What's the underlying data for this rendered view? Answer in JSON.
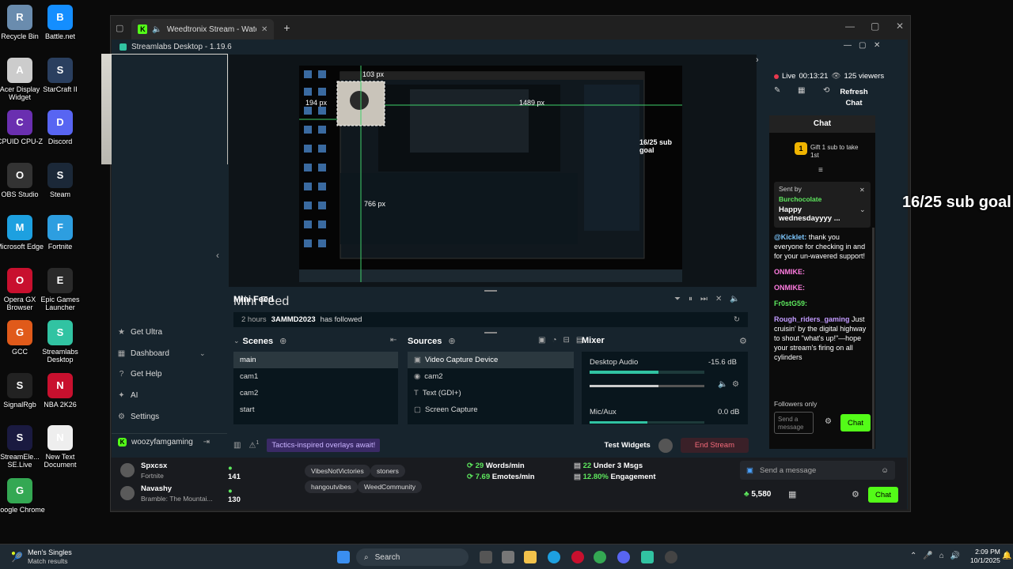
{
  "desktop_icons": [
    {
      "label": "Recycle Bin",
      "icon": "recycle-bin-icon",
      "color": "#6a8cae"
    },
    {
      "label": "Battle.net",
      "icon": "battlenet-icon",
      "color": "#148eff"
    },
    {
      "label": "Acer Display Widget",
      "icon": "acer-icon",
      "color": "#cccccc"
    },
    {
      "label": "StarCraft II",
      "icon": "starcraft-icon",
      "color": "#2a3f5f"
    },
    {
      "label": "CPUID CPU-Z",
      "icon": "cpuz-icon",
      "color": "#6a2fb0"
    },
    {
      "label": "Discord",
      "icon": "discord-icon",
      "color": "#5865f2"
    },
    {
      "label": "OBS Studio",
      "icon": "obs-icon",
      "color": "#333333"
    },
    {
      "label": "Steam",
      "icon": "steam-icon",
      "color": "#1b2838"
    },
    {
      "label": "Microsoft Edge",
      "icon": "edge-icon",
      "color": "#1da0e0"
    },
    {
      "label": "Fortnite",
      "icon": "fortnite-icon",
      "color": "#2d9ee0"
    },
    {
      "label": "Opera GX Browser",
      "icon": "opera-icon",
      "color": "#c8102e"
    },
    {
      "label": "Epic Games Launcher",
      "icon": "epic-icon",
      "color": "#2a2a2a"
    },
    {
      "label": "GCC",
      "icon": "gcc-icon",
      "color": "#e05a1a"
    },
    {
      "label": "Streamlabs Desktop",
      "icon": "streamlabs-icon",
      "color": "#31c3a2"
    },
    {
      "label": "SignalRgb",
      "icon": "signalrgb-icon",
      "color": "#222222"
    },
    {
      "label": "NBA 2K26",
      "icon": "nba-icon",
      "color": "#c8102e"
    },
    {
      "label": "StreamEle... SE.Live",
      "icon": "streamelements-icon",
      "color": "#1a1a40"
    },
    {
      "label": "New Text Document",
      "icon": "text-document-icon",
      "color": "#eeeeee"
    },
    {
      "label": "Google Chrome",
      "icon": "chrome-icon",
      "color": "#34a853"
    }
  ],
  "browser": {
    "tab_title": "Weedtronix Stream - Watch",
    "new_tab": "+"
  },
  "streamlabs": {
    "title": "Streamlabs Desktop - 1.19.6",
    "status": {
      "live": "Live",
      "time": "00:13:21",
      "viewers": "125 viewers"
    },
    "refresh_chat": "Refresh Chat",
    "sidebar": [
      {
        "label": "Get Ultra",
        "icon": "ultra-icon"
      },
      {
        "label": "Dashboard",
        "icon": "dashboard-icon"
      },
      {
        "label": "Get Help",
        "icon": "help-icon"
      },
      {
        "label": "AI",
        "icon": "ai-icon"
      },
      {
        "label": "Settings",
        "icon": "gear-icon"
      }
    ],
    "account": "woozyfamgaming",
    "preview_labels": {
      "w": "103 px",
      "h": "194 px",
      "x": "1489 px",
      "y": "766 px",
      "goal": "16/25 sub goal"
    },
    "minifeed": {
      "title": "Mini Feed",
      "entry": {
        "time": "2 hours",
        "user": "3AMMD2023",
        "action": "has followed"
      }
    },
    "scenes": {
      "title": "Scenes",
      "items": [
        "main",
        "cam1",
        "cam2",
        "start"
      ],
      "selected": "main"
    },
    "sources": {
      "title": "Sources",
      "items": [
        "Video Capture Device",
        "cam2",
        "Text (GDI+)",
        "Screen Capture"
      ]
    },
    "mixer": {
      "title": "Mixer",
      "channels": [
        {
          "name": "Desktop Audio",
          "db": "-15.6 dB",
          "level": 0.6
        },
        {
          "name": "Mic/Aux",
          "db": "0.0 dB",
          "level": 0.5
        }
      ]
    },
    "bottom": {
      "promo": "Tactics-inspired overlays await!",
      "test_widgets": "Test Widgets",
      "end_stream": "End Stream",
      "alerts": "1"
    },
    "chat": {
      "title": "Chat",
      "gift": "Gift 1 sub to take 1st",
      "pinned": {
        "label": "Sent by",
        "user": "Burchocolate",
        "text": "Happy wednesdayyyy ..."
      },
      "messages": [
        {
          "user": "@Kicklet:",
          "color": "#7ec8ff",
          "text": "thank you everyone for checking in and for your un-wavered support!"
        },
        {
          "user": "ONMIKE:",
          "color": "#ff7ce0",
          "text": ""
        },
        {
          "user": "ONMIKE:",
          "color": "#ff7ce0",
          "text": ""
        },
        {
          "user": "Fr0stG59:",
          "color": "#5ee85e",
          "text": ""
        },
        {
          "user": "Rough_riders_gaming",
          "color": "#c39bff",
          "text": "Just cruisin' by the digital highway to shout \"what's up!\"—hope your stream's firing on all cylinders"
        }
      ],
      "followers_only": "Followers only",
      "placeholder": "Send a message",
      "send": "Chat"
    }
  },
  "kick": {
    "viewers": [
      {
        "name": "Spxcsx",
        "game": "Fortnite",
        "count": "141"
      },
      {
        "name": "Navashy",
        "game": "Bramble: The Mountai...",
        "count": "130"
      }
    ],
    "tags": [
      "VibesNotVictories",
      "stoners",
      "hangoutvibes",
      "WeedCommunity"
    ],
    "stats": {
      "wpm": "29",
      "wpm_label": "Words/min",
      "epm": "7.69",
      "epm_label": "Emotes/min",
      "under": "22",
      "under_label": "Under 3 Msgs",
      "engagement": "12.80%",
      "engagement_label": "Engagement"
    },
    "chat_placeholder": "Send a message",
    "points": "5,580",
    "chat_button": "Chat"
  },
  "overlay_goal": "16/25 sub goal",
  "taskbar": {
    "notification_title": "Men's Singles",
    "notification_sub": "Match results",
    "search": "Search",
    "time": "2:09 PM",
    "date": "10/1/2025"
  }
}
